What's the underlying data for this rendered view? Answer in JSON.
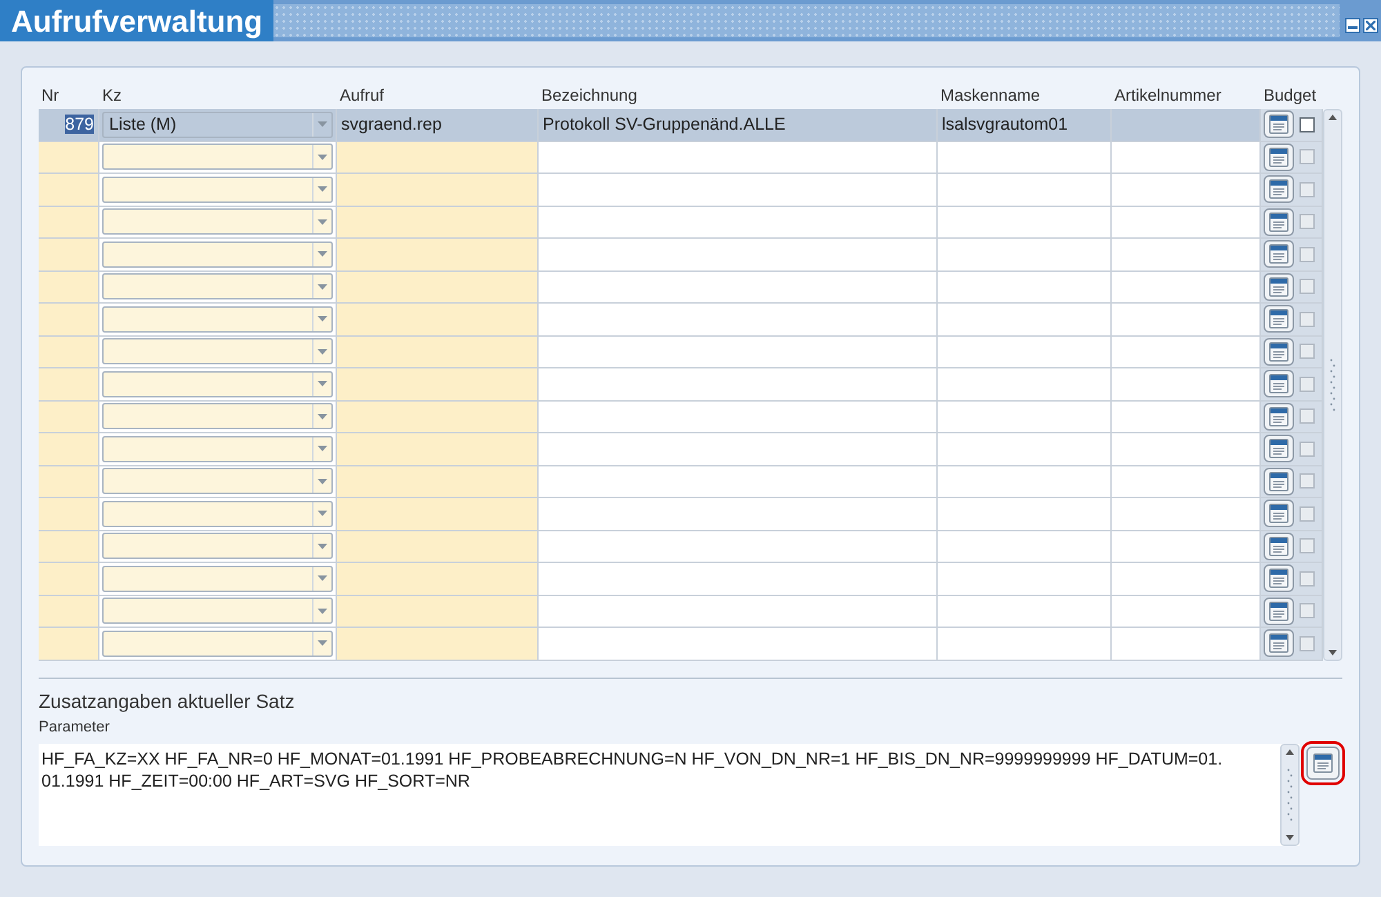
{
  "window": {
    "title": "Aufrufverwaltung"
  },
  "table": {
    "columns": [
      "Nr",
      "Kz",
      "Aufruf",
      "Bezeichnung",
      "Maskenname",
      "Artikelnummer",
      "Budget"
    ],
    "rows": [
      {
        "nr": "879",
        "kz": "Liste (M)",
        "aufruf": "svgraend.rep",
        "bezeichnung": "Protokoll SV-Gruppenänd.ALLE",
        "maskenname": "lsalsvgrautom01",
        "selected": true,
        "checked": false,
        "disabled": false
      },
      {
        "selected": false,
        "checked": false,
        "disabled": true
      },
      {
        "selected": false,
        "checked": false,
        "disabled": true
      },
      {
        "selected": false,
        "checked": false,
        "disabled": true
      },
      {
        "selected": false,
        "checked": false,
        "disabled": true
      },
      {
        "selected": false,
        "checked": false,
        "disabled": true
      },
      {
        "selected": false,
        "checked": false,
        "disabled": true
      },
      {
        "selected": false,
        "checked": false,
        "disabled": true
      },
      {
        "selected": false,
        "checked": false,
        "disabled": true
      },
      {
        "selected": false,
        "checked": false,
        "disabled": true
      },
      {
        "selected": false,
        "checked": false,
        "disabled": true
      },
      {
        "selected": false,
        "checked": false,
        "disabled": true
      },
      {
        "selected": false,
        "checked": false,
        "disabled": true
      },
      {
        "selected": false,
        "checked": false,
        "disabled": true
      },
      {
        "selected": false,
        "checked": false,
        "disabled": true
      },
      {
        "selected": false,
        "checked": false,
        "disabled": true
      },
      {
        "selected": false,
        "checked": false,
        "disabled": true
      }
    ]
  },
  "details": {
    "heading": "Zusatzangaben aktueller Satz",
    "parameter_label": "Parameter",
    "parameter_value": "HF_FA_KZ=XX HF_FA_NR=0 HF_MONAT=01.1991 HF_PROBEABRECHNUNG=N HF_VON_DN_NR=1 HF_BIS_DN_NR=9999999999 HF_DATUM=01.\n01.1991 HF_ZEIT=00:00 HF_ART=SVG HF_SORT=NR",
    "edit_button_highlighted": true
  }
}
